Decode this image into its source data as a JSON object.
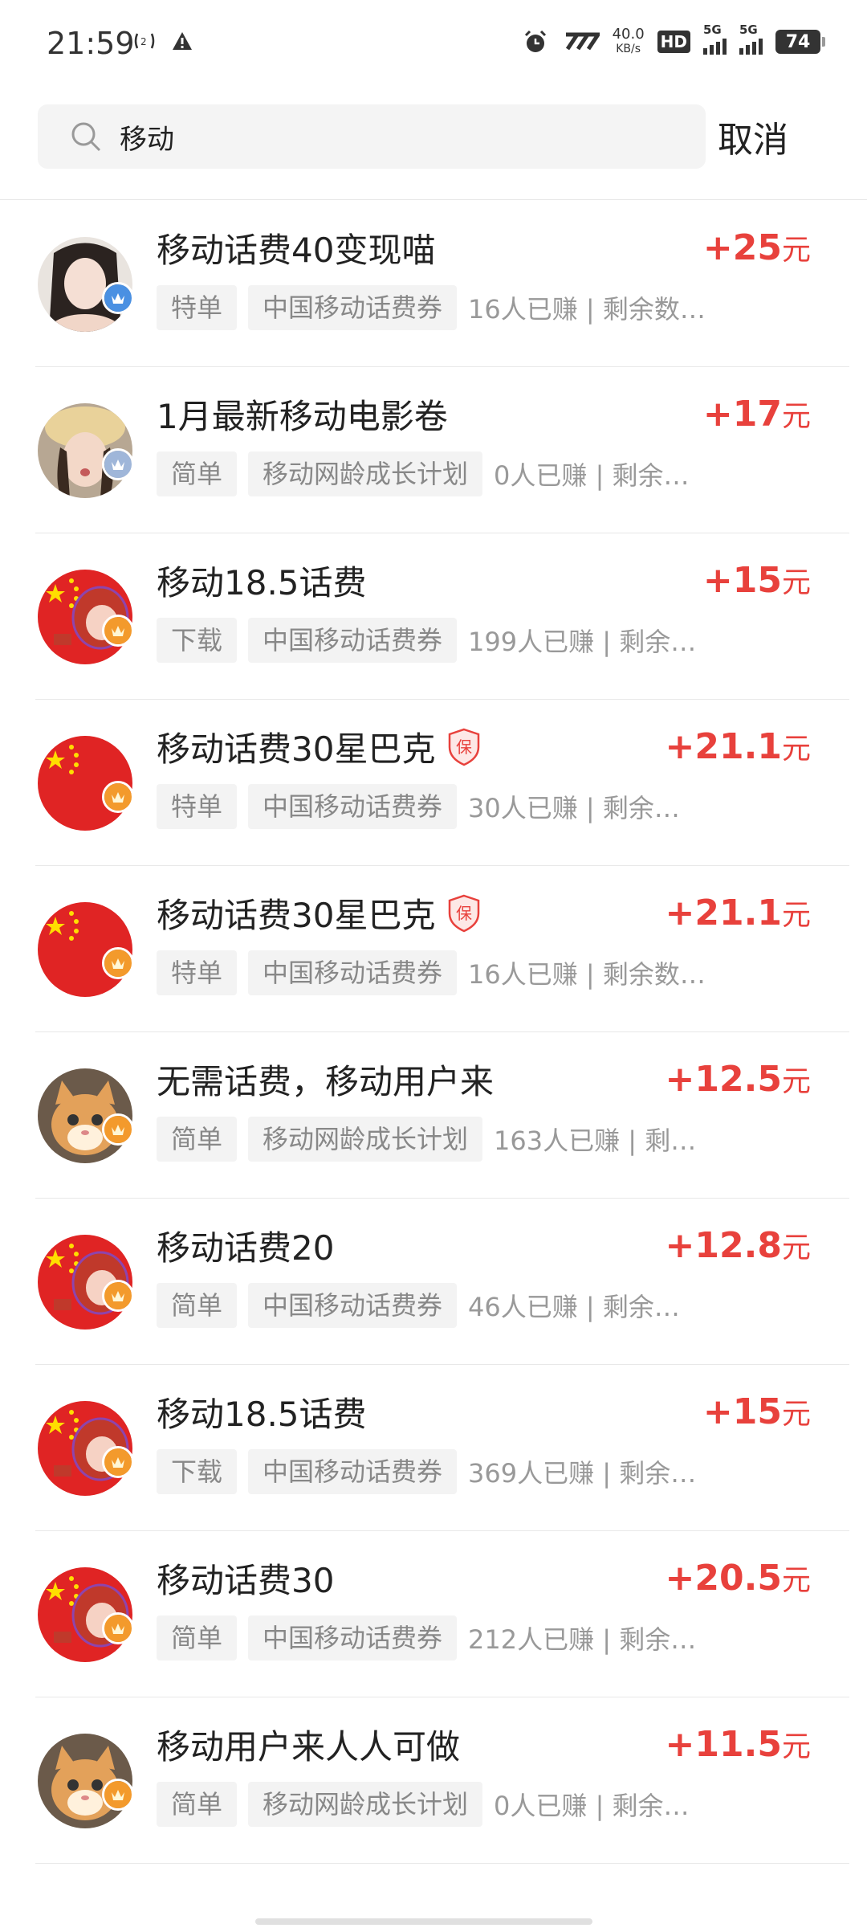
{
  "status_bar": {
    "time": "21:59",
    "speed_value": "40.0",
    "speed_unit": "KB/s",
    "hd_label": "HD",
    "net1": "5G",
    "net2": "5G",
    "battery": "74"
  },
  "search": {
    "value": "移动",
    "cancel_label": "取消"
  },
  "colors": {
    "accent": "#e8413c",
    "tag_bg": "#f3f3f3"
  },
  "items": [
    {
      "title": "移动话费40变现喵",
      "reward_value": "+25",
      "reward_unit": "元",
      "tag1": "特单",
      "tag2": "中国移动话费券",
      "meta": "16人已赚 | 剩余数…",
      "avatar": "girl-photo",
      "badge": "blue",
      "guarantee": false
    },
    {
      "title": "1月最新移动电影卷",
      "reward_value": "+17",
      "reward_unit": "元",
      "tag1": "简单",
      "tag2": "移动网龄成长计划",
      "meta": "0人已赚 | 剩余…",
      "avatar": "girl-hat-photo",
      "badge": "silver",
      "guarantee": false
    },
    {
      "title": "移动18.5话费",
      "reward_value": "+15",
      "reward_unit": "元",
      "tag1": "下载",
      "tag2": "中国移动话费券",
      "meta": "199人已赚 | 剩余…",
      "avatar": "flag-helmet",
      "badge": "orange",
      "guarantee": false
    },
    {
      "title": "移动话费30星巴克",
      "reward_value": "+21.1",
      "reward_unit": "元",
      "tag1": "特单",
      "tag2": "中国移动话费券",
      "meta": "30人已赚 | 剩余…",
      "avatar": "flag",
      "badge": "orange",
      "guarantee": true,
      "guarantee_label": "保"
    },
    {
      "title": "移动话费30星巴克",
      "reward_value": "+21.1",
      "reward_unit": "元",
      "tag1": "特单",
      "tag2": "中国移动话费券",
      "meta": "16人已赚 | 剩余数…",
      "avatar": "flag",
      "badge": "orange",
      "guarantee": true,
      "guarantee_label": "保"
    },
    {
      "title": "无需话费，移动用户来",
      "reward_value": "+12.5",
      "reward_unit": "元",
      "tag1": "简单",
      "tag2": "移动网龄成长计划",
      "meta": "163人已赚 | 剩…",
      "avatar": "cat",
      "badge": "orange",
      "guarantee": false
    },
    {
      "title": "移动话费20",
      "reward_value": "+12.8",
      "reward_unit": "元",
      "tag1": "简单",
      "tag2": "中国移动话费券",
      "meta": "46人已赚 | 剩余…",
      "avatar": "flag-helmet",
      "badge": "orange",
      "guarantee": false
    },
    {
      "title": "移动18.5话费",
      "reward_value": "+15",
      "reward_unit": "元",
      "tag1": "下载",
      "tag2": "中国移动话费券",
      "meta": "369人已赚 | 剩余…",
      "avatar": "flag-helmet",
      "badge": "orange",
      "guarantee": false
    },
    {
      "title": "移动话费30",
      "reward_value": "+20.5",
      "reward_unit": "元",
      "tag1": "简单",
      "tag2": "中国移动话费券",
      "meta": "212人已赚 | 剩余…",
      "avatar": "flag-helmet",
      "badge": "orange",
      "guarantee": false
    },
    {
      "title": "移动用户来人人可做",
      "reward_value": "+11.5",
      "reward_unit": "元",
      "tag1": "简单",
      "tag2": "移动网龄成长计划",
      "meta": "0人已赚 | 剩余…",
      "avatar": "cat",
      "badge": "orange",
      "guarantee": false
    }
  ]
}
